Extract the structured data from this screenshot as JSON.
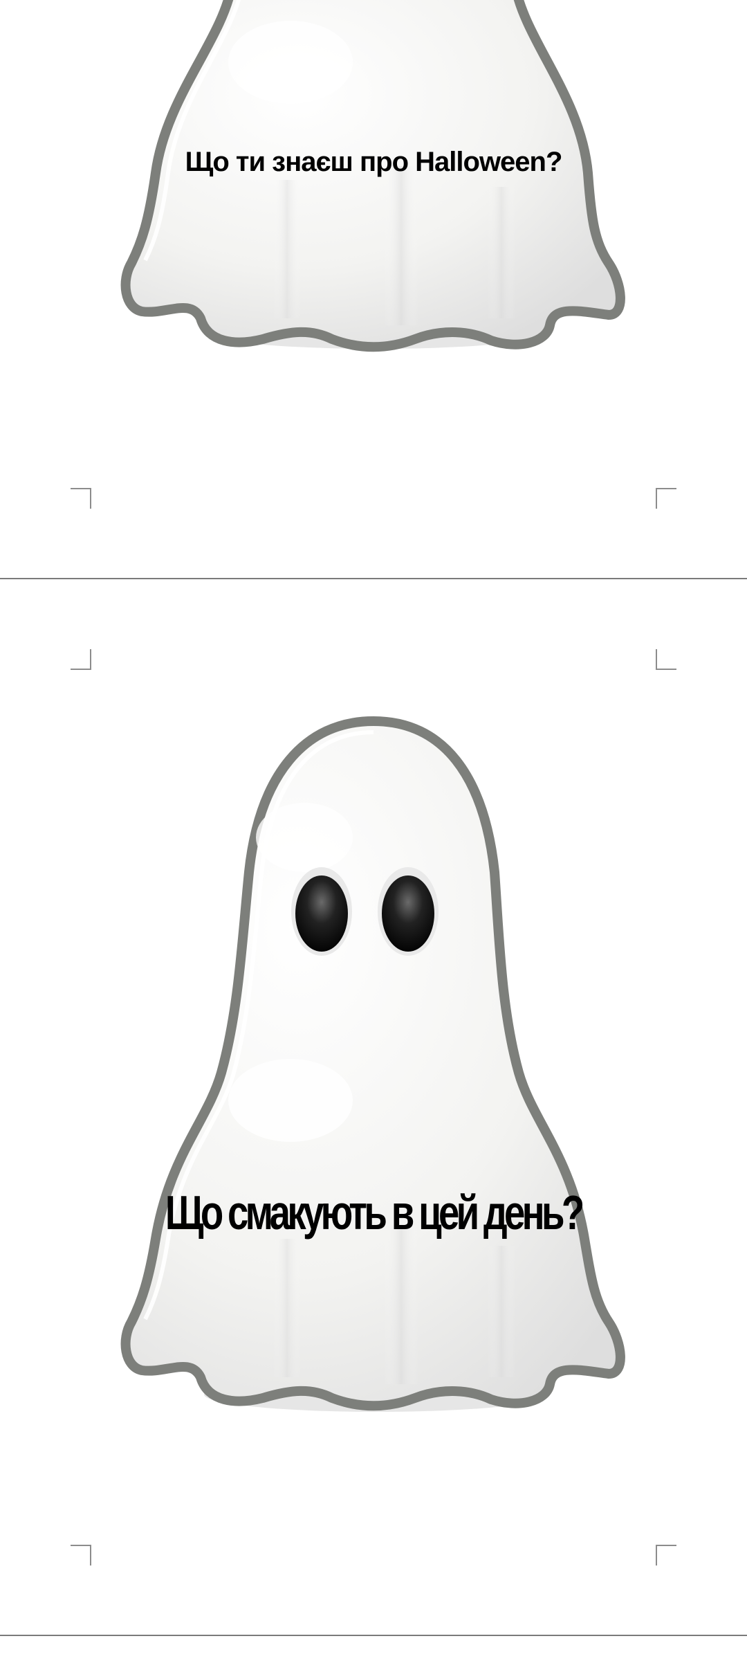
{
  "pages": [
    {
      "question": "Що ти знаєш про Halloween?"
    },
    {
      "question": "Що смакують в цей день?"
    }
  ],
  "colors": {
    "ghost_outline": "#7d7f7b",
    "ghost_fill": "#f6f6f4",
    "eye": "#111111",
    "page_separator": "#7a7a7a"
  },
  "icons": {
    "ghost": "ghost-illustration",
    "crop_marks": "crop-mark"
  }
}
